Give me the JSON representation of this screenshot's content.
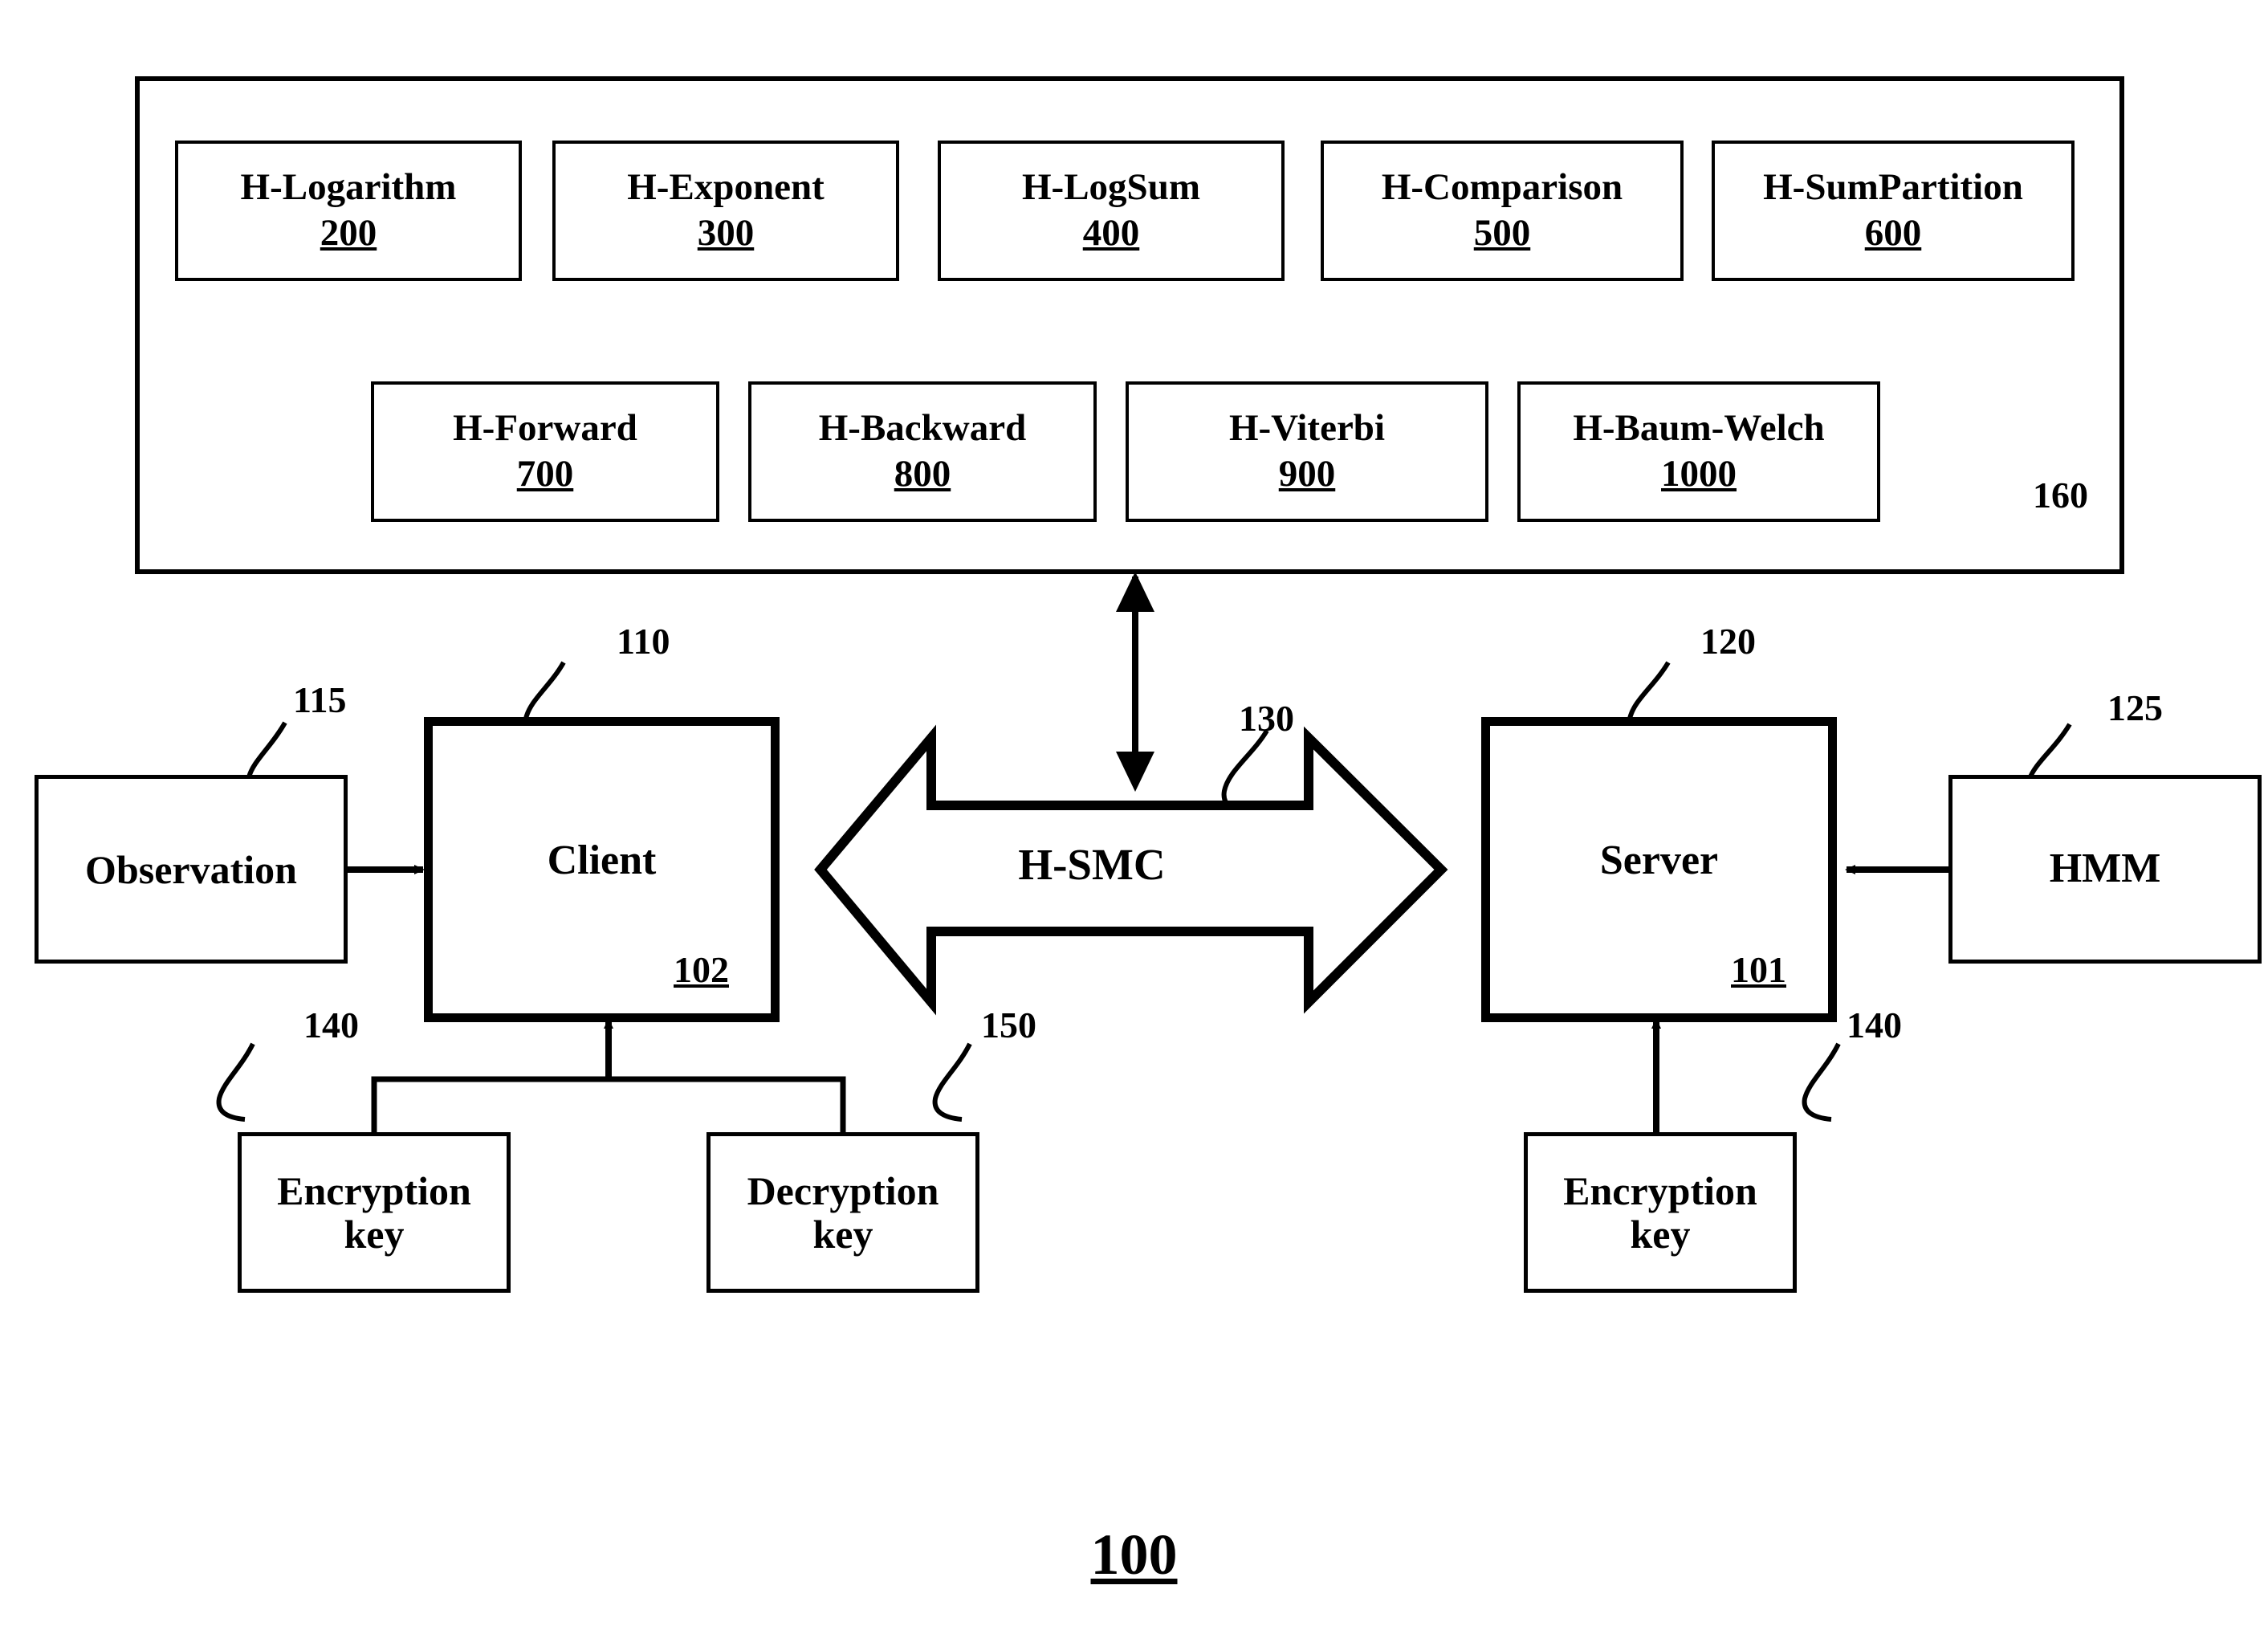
{
  "figure": {
    "number": "100"
  },
  "framework": {
    "ref": "160",
    "row1": [
      {
        "title": "H-Logarithm",
        "ref": "200"
      },
      {
        "title": "H-Exponent",
        "ref": "300"
      },
      {
        "title": "H-LogSum",
        "ref": "400"
      },
      {
        "title": "H-Comparison",
        "ref": "500"
      },
      {
        "title": "H-SumPartition",
        "ref": "600"
      }
    ],
    "row2": [
      {
        "title": "H-Forward",
        "ref": "700"
      },
      {
        "title": "H-Backward",
        "ref": "800"
      },
      {
        "title": "H-Viterbi",
        "ref": "900"
      },
      {
        "title": "H-Baum-Welch",
        "ref": "1000"
      }
    ]
  },
  "nodes": {
    "observation": {
      "title": "Observation",
      "ref": "115"
    },
    "client": {
      "title": "Client",
      "inner_ref": "102",
      "ref": "110"
    },
    "hsmc": {
      "title": "H-SMC",
      "ref": "130"
    },
    "server": {
      "title": "Server",
      "inner_ref": "101",
      "ref": "120"
    },
    "hmm": {
      "title": "HMM",
      "ref": "125"
    },
    "client_encryption_key": {
      "title_line1": "Encryption",
      "title_line2": "key",
      "ref": "140"
    },
    "client_decryption_key": {
      "title_line1": "Decryption",
      "title_line2": "key",
      "ref": "150"
    },
    "server_encryption_key": {
      "title_line1": "Encryption",
      "title_line2": "key",
      "ref": "140"
    }
  },
  "colors": {
    "stroke": "#000000",
    "background": "#ffffff"
  }
}
